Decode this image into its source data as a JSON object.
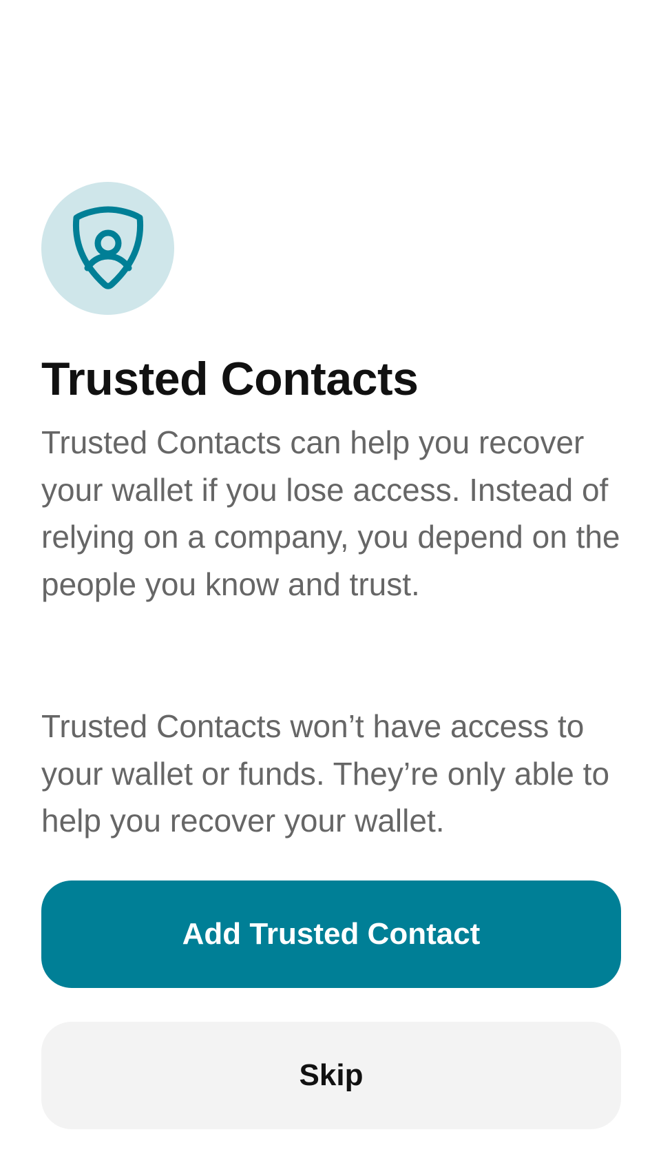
{
  "header": {
    "title": "Trusted Contacts",
    "icon": "shield-person-icon"
  },
  "body": {
    "paragraph_1": "Trusted Contacts can help you recover your wallet if you lose access. Instead of relying on a company, you depend on the people you know and trust.",
    "paragraph_2": "Trusted Contacts won’t have access to your wallet or funds. They’re only able to help you recover your wallet."
  },
  "actions": {
    "primary_label": "Add Trusted Contact",
    "secondary_label": "Skip"
  },
  "colors": {
    "accent": "#007f96",
    "badge_background": "#cfe6ea",
    "title_text": "#111111",
    "body_text": "#666666",
    "secondary_button": "#f3f3f3"
  }
}
